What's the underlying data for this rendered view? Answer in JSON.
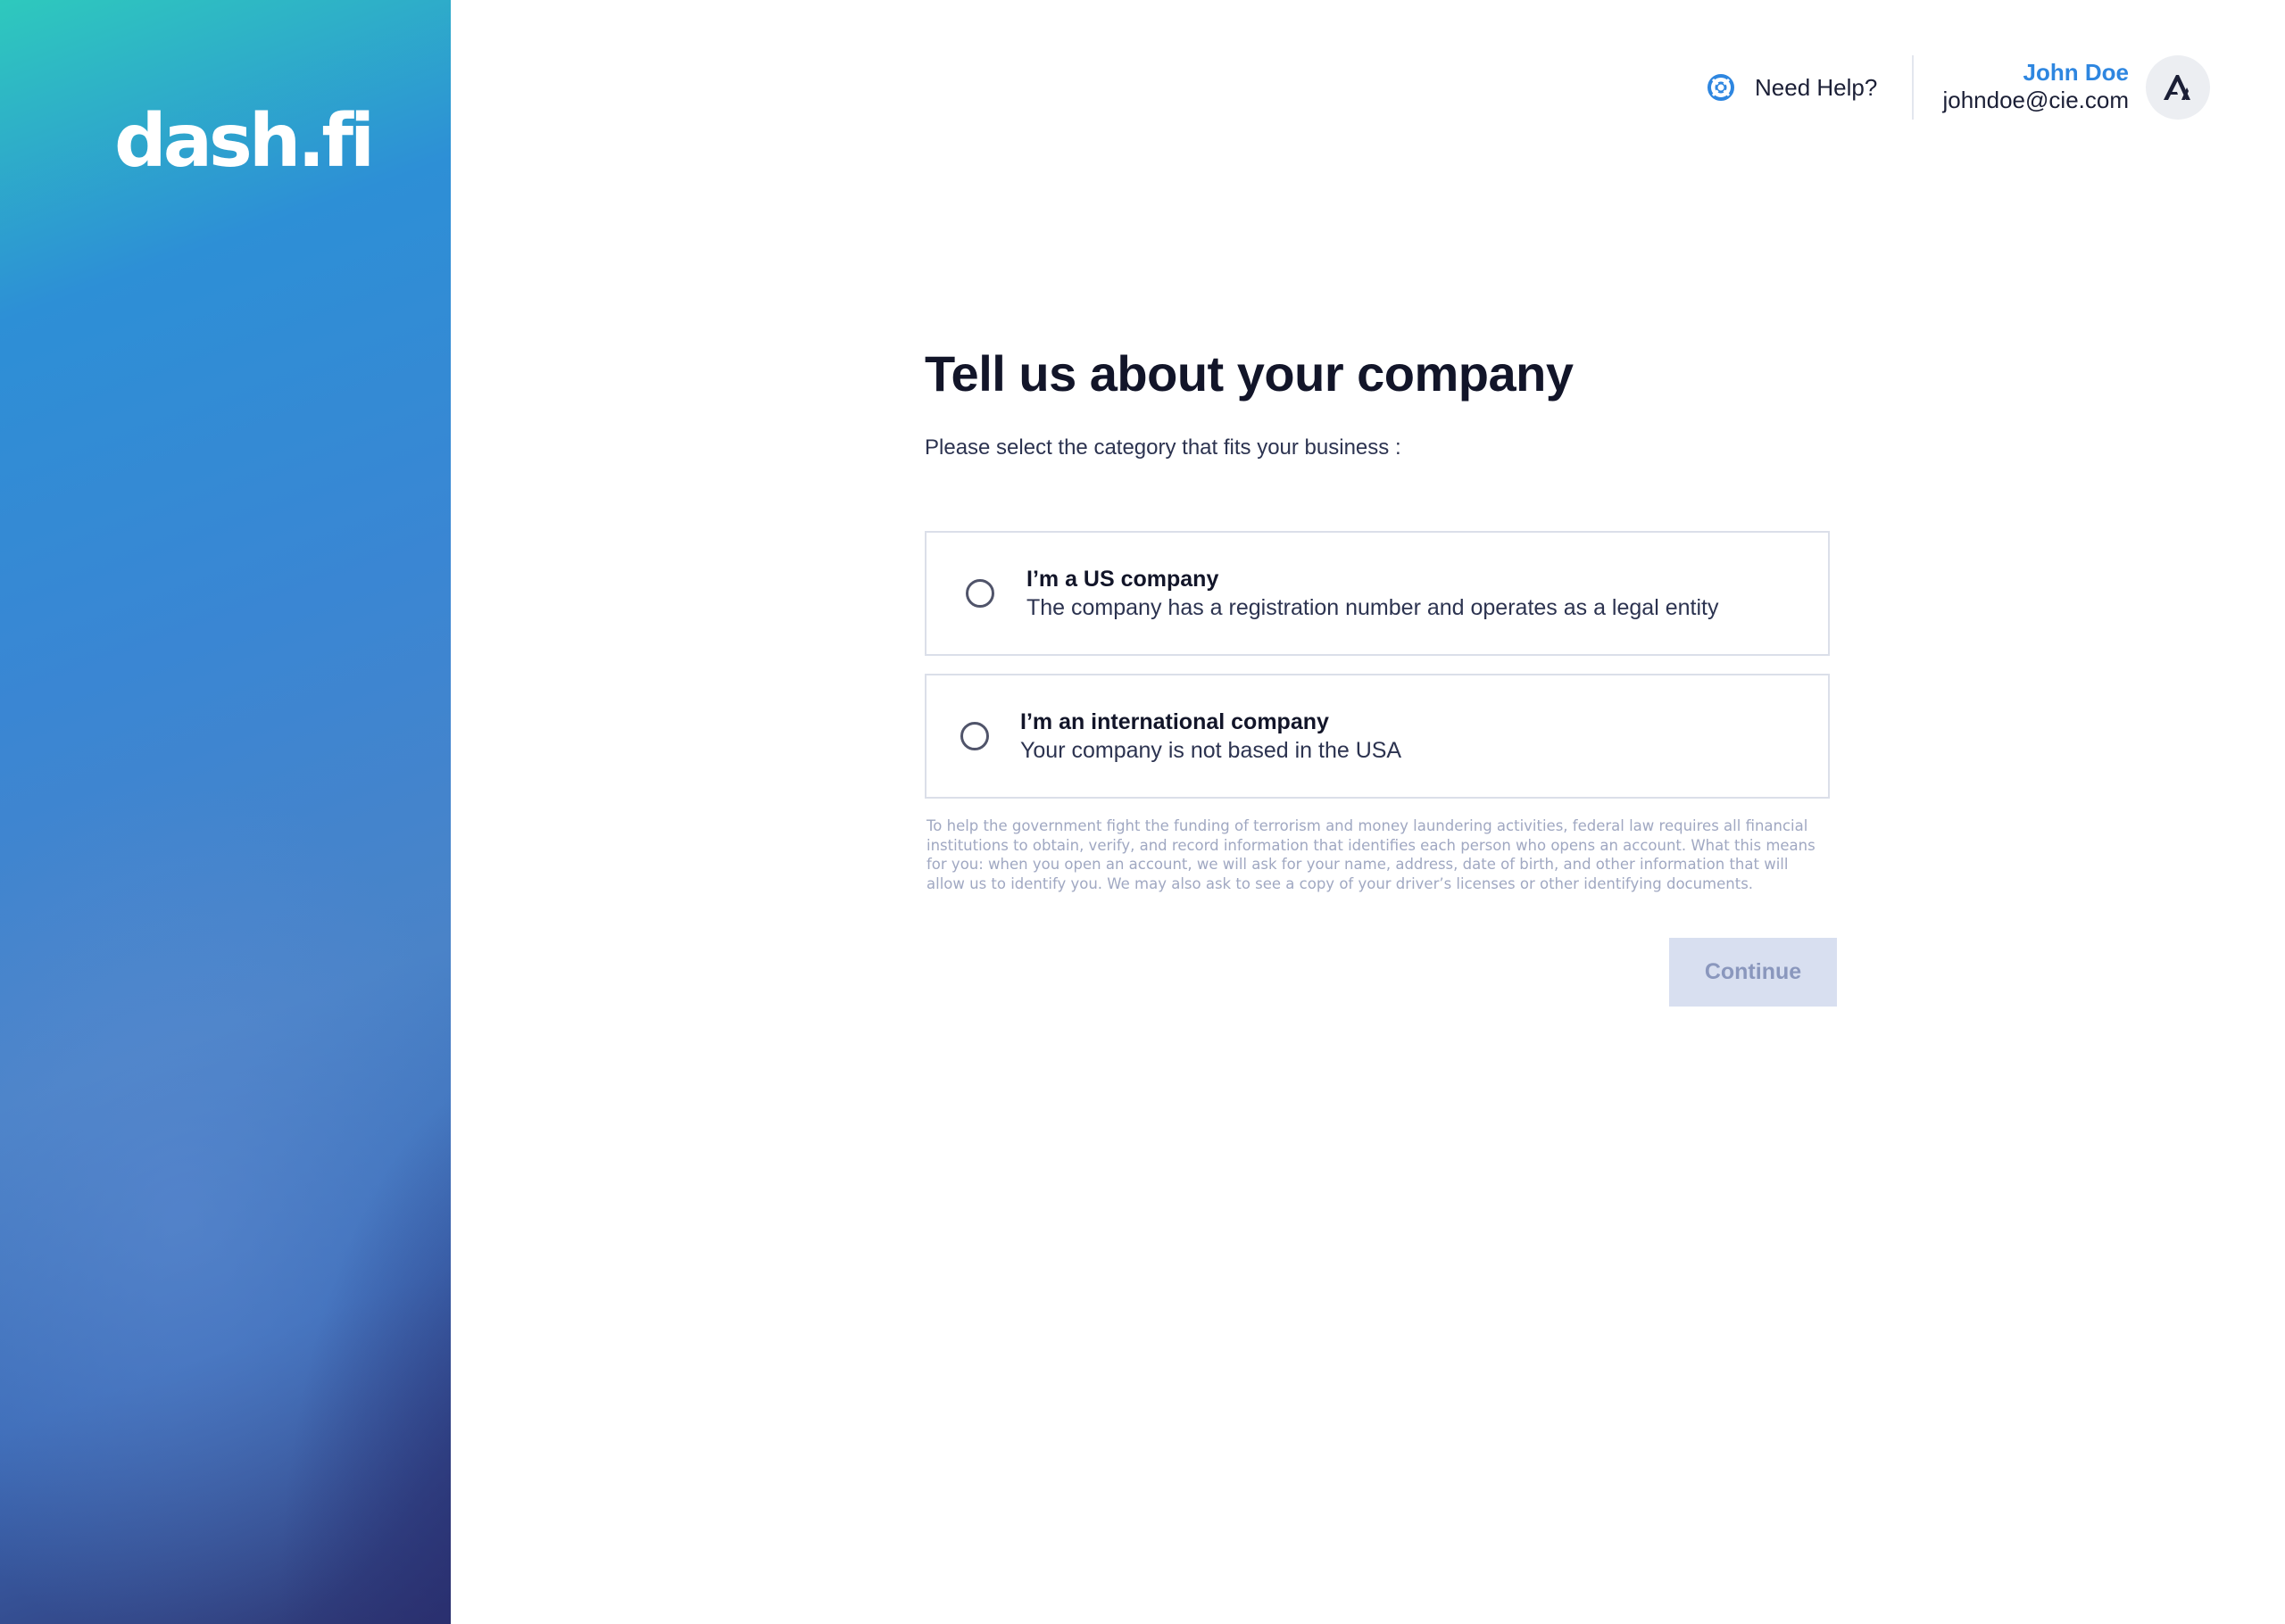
{
  "brand": {
    "logo_text": "dash.fi",
    "sidebar_gradient": [
      "#2ec9bd",
      "#2d8fd6",
      "#4a83c8",
      "#2d3470"
    ]
  },
  "header": {
    "help_label": "Need Help?",
    "help_icon": "lifebuoy-icon",
    "user": {
      "name": "John Doe",
      "email": "johndoe@cie.com",
      "avatar_icon": "avatar-logo-icon"
    }
  },
  "main": {
    "title": "Tell us about your company",
    "subtitle": "Please select the category that fits your business :",
    "options": [
      {
        "title": "I’m a US company",
        "description": "The company has a registration number and operates as a legal entity",
        "selected": false
      },
      {
        "title": "I’m an international company",
        "description": "Your company is not based in the USA",
        "selected": false
      }
    ],
    "disclaimer": "To help the government fight the funding of terrorism and money laundering activities, federal law requires all financial institutions to obtain, verify, and record information that identifies each person who opens an account. What this means for you: when you open an account, we will ask for your name, address, date of birth, and other information that will allow us to identify you. We may also ask to see a copy of your driver’s licenses or other identifying documents.",
    "continue_label": "Continue",
    "continue_disabled": true
  },
  "colors": {
    "accent": "#2e86e0",
    "button_disabled_bg": "#d8dff0",
    "button_disabled_text": "#8a97bd"
  }
}
